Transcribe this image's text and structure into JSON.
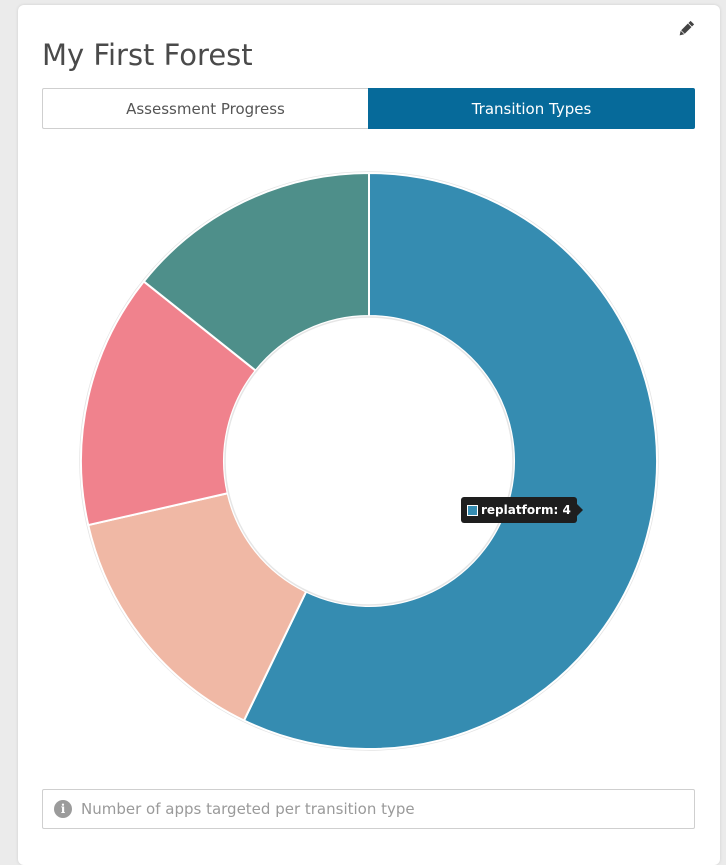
{
  "card": {
    "title": "My First Forest"
  },
  "tabs": [
    {
      "label": "Assessment Progress",
      "active": false
    },
    {
      "label": "Transition Types",
      "active": true
    }
  ],
  "icons": {
    "edit": "pencil-icon",
    "info": "info-circle-icon"
  },
  "colors": {
    "active_tab": "#066a9a",
    "replatform": "#358cb1",
    "slice_peach": "#f0b8a5",
    "slice_pink": "#f0828d",
    "slice_teal": "#4e8f8a"
  },
  "chart_data": {
    "type": "pie",
    "variant": "donut",
    "slices": [
      {
        "label": "replatform",
        "value": 4,
        "color": "#358cb1"
      },
      {
        "value": 1,
        "color": "#f0b8a5"
      },
      {
        "value": 1,
        "color": "#f0828d"
      },
      {
        "value": 1,
        "color": "#4e8f8a"
      }
    ],
    "start_angle_deg": 0,
    "direction": "clockwise"
  },
  "tooltip": {
    "text": "replatform: 4",
    "color": "#358cb1"
  },
  "info": {
    "icon_glyph": "i",
    "text": "Number of apps targeted per transition type"
  }
}
